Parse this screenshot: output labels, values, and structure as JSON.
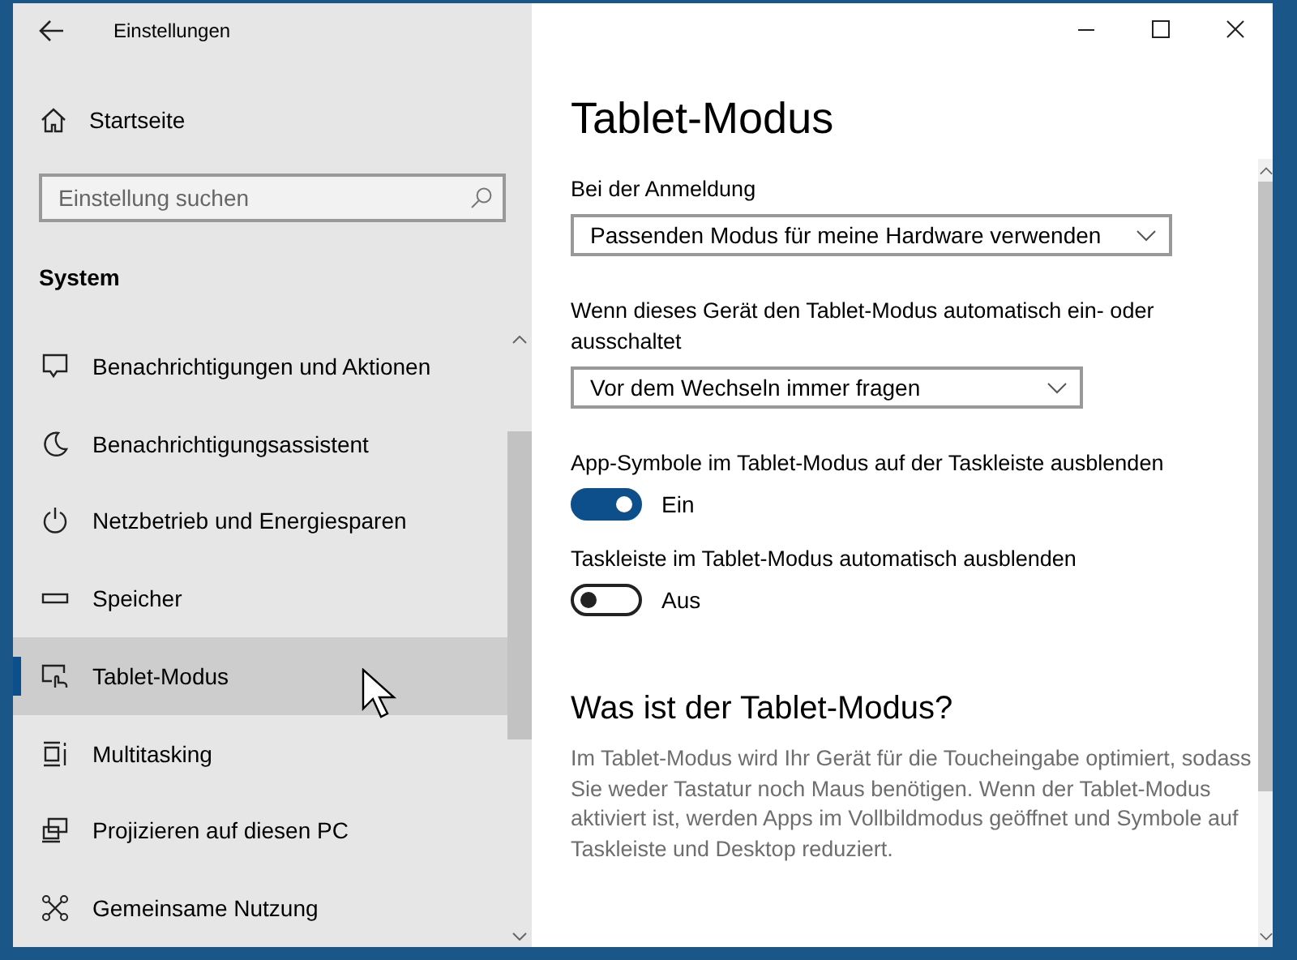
{
  "window": {
    "title": "Einstellungen"
  },
  "sidebar": {
    "home": "Startseite",
    "search": {
      "placeholder": "Einstellung suchen"
    },
    "section": "System",
    "items": [
      {
        "label": "Benachrichtigungen und Aktionen",
        "selected": false
      },
      {
        "label": "Benachrichtigungsassistent",
        "selected": false
      },
      {
        "label": "Netzbetrieb und Energiesparen",
        "selected": false
      },
      {
        "label": "Speicher",
        "selected": false
      },
      {
        "label": "Tablet-Modus",
        "selected": true
      },
      {
        "label": "Multitasking",
        "selected": false
      },
      {
        "label": "Projizieren auf diesen PC",
        "selected": false
      },
      {
        "label": "Gemeinsame Nutzung",
        "selected": false
      }
    ]
  },
  "content": {
    "title": "Tablet-Modus",
    "settings": [
      {
        "kind": "dropdown",
        "label": "Bei der Anmeldung",
        "value": "Passenden Modus für meine Hardware verwenden"
      },
      {
        "kind": "dropdown",
        "label": "Wenn dieses Gerät den Tablet-Modus automatisch ein- oder ausschaltet",
        "value": "Vor dem Wechseln immer fragen"
      },
      {
        "kind": "toggle",
        "label": "App-Symbole im Tablet-Modus auf der Taskleiste ausblenden",
        "on": true,
        "state_text": "Ein"
      },
      {
        "kind": "toggle",
        "label": "Taskleiste im Tablet-Modus automatisch ausblenden",
        "on": false,
        "state_text": "Aus"
      }
    ],
    "info": {
      "heading": "Was ist der Tablet-Modus?",
      "text": "Im Tablet-Modus wird Ihr Gerät für die Toucheingabe optimiert, sodass Sie weder Tastatur noch Maus benötigen. Wenn der Tablet-Modus aktiviert ist, werden Apps im Vollbildmodus geöffnet und Symbole auf Taskleiste und Desktop reduziert."
    }
  }
}
